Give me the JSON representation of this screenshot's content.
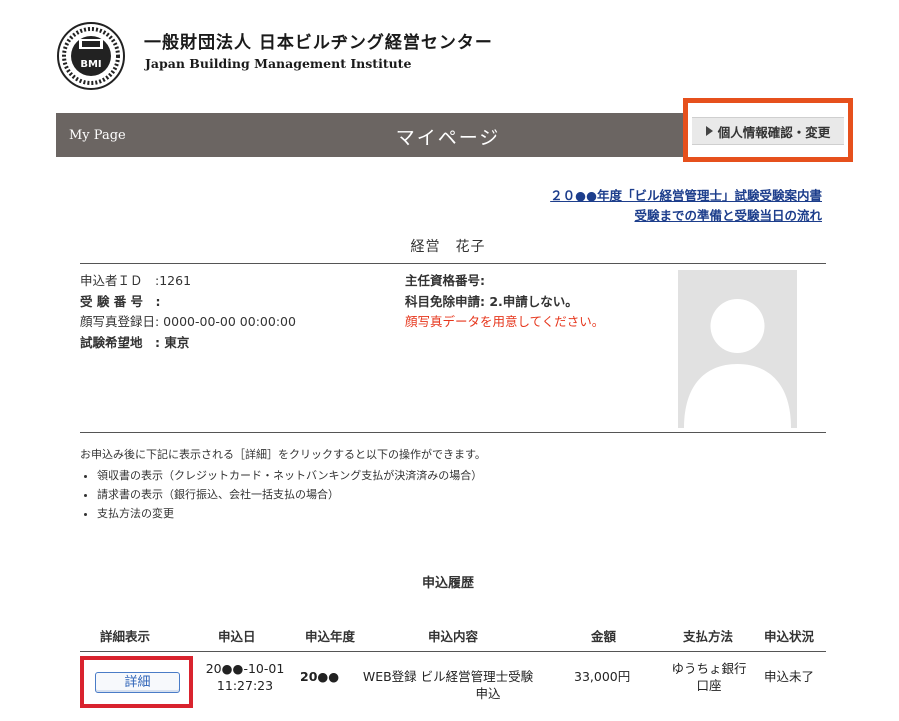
{
  "header": {
    "org_name_jp": "一般財団法人  日本ビルヂング経営センター",
    "org_name_en": "Japan Building Management Institute",
    "logo_text": "BMI"
  },
  "titlebar": {
    "mypage_label": "My Page",
    "title": "マイページ",
    "profile_button": "個人情報確認・変更"
  },
  "links": {
    "guide": "２０●●年度「ビル経営管理士」試験受験案内書",
    "flow": "受験までの準備と受験当日の流れ"
  },
  "user": {
    "name": "経営　花子",
    "applicant_id": "申込者ＩＤ　:1261",
    "exam_number": "受 験 番 号　:",
    "photo_registered": "顔写真登録日: 0000-00-00 00:00:00",
    "exam_location": "試験希望地　:  東京",
    "license_number": "主任資格番号:",
    "exemption": "科目免除申請: 2.申請しない。",
    "photo_warning": "顔写真データを用意してください。"
  },
  "notes": {
    "intro": "お申込み後に下記に表示される［詳細］をクリックすると以下の操作ができます。",
    "items": [
      "領収書の表示（クレジットカード・ネットバンキング支払が決済済みの場合）",
      "請求書の表示（銀行振込、会社一括支払の場合）",
      "支払方法の変更"
    ]
  },
  "history": {
    "title": "申込履歴",
    "columns": [
      "詳細表示",
      "申込日",
      "申込年度",
      "申込内容",
      "金額",
      "支払方法",
      "申込状況"
    ],
    "rows": [
      {
        "detail_button": "詳細",
        "date_line1": "20●●-10-01",
        "date_line2": "11:27:23",
        "year": "20●●",
        "content_line1": "WEB登録 ビル経営管理士受験",
        "content_line2": "申込",
        "amount": "33,000円",
        "payment_line1": "ゆうちょ銀行",
        "payment_line2": "口座",
        "status": "申込未了"
      }
    ]
  },
  "colors": {
    "titlebar": "#6b6562",
    "highlight_orange": "#e6501c",
    "highlight_red": "#d9232e",
    "link_blue": "#1d3e8c",
    "warning_red": "#e6361c"
  }
}
